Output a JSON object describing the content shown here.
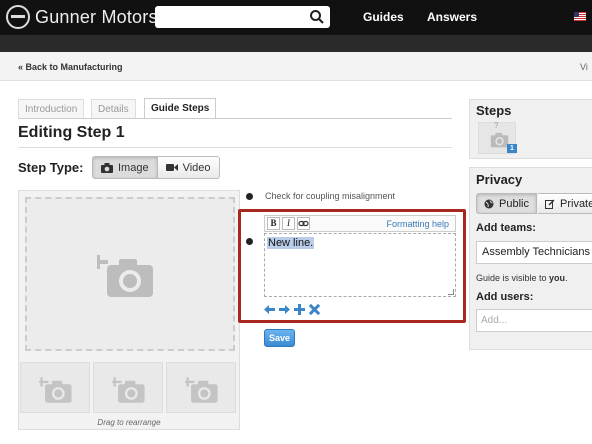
{
  "header": {
    "brand": "Gunner Motors",
    "search_placeholder": "",
    "nav": [
      "Guides",
      "Answers"
    ]
  },
  "breadcrumb": {
    "back_label": "« Back to Manufacturing",
    "right_label": "Vi"
  },
  "tabs": [
    {
      "label": "Introduction",
      "active": false
    },
    {
      "label": "Details",
      "active": false
    },
    {
      "label": "Guide Steps",
      "active": true
    }
  ],
  "editor": {
    "page_title": "Editing Step 1",
    "step_type_label": "Step Type:",
    "step_type_options": [
      "Image",
      "Video"
    ],
    "bullet_1": "Check for coupling misalignment",
    "toolbar": {
      "bold": "B",
      "italic": "I",
      "formatting_help": "Formatting help"
    },
    "bullet_2_value": "New line.",
    "save_label": "Save",
    "drag_label": "Drag to rearrange"
  },
  "sidebar": {
    "steps_heading": "Steps",
    "step_badge": "1",
    "privacy_heading": "Privacy",
    "privacy_options": [
      "Public",
      "Private"
    ],
    "add_teams_label": "Add teams:",
    "team_value": "Assembly Technicians",
    "visibility_prefix": "Guide is visible to ",
    "visibility_who": "you",
    "visibility_suffix": ".",
    "add_users_label": "Add users:",
    "users_placeholder": "Add..."
  },
  "colors": {
    "topbar": "#111111",
    "highlight": "#a8281e",
    "accent": "#3a86c8"
  }
}
